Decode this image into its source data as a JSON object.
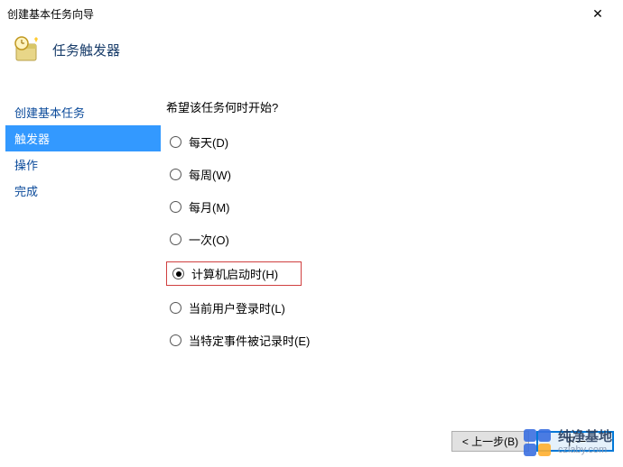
{
  "window": {
    "title": "创建基本任务向导"
  },
  "header": {
    "title": "任务触发器"
  },
  "sidebar": {
    "items": [
      {
        "label": "创建基本任务"
      },
      {
        "label": "触发器"
      },
      {
        "label": "操作"
      },
      {
        "label": "完成"
      }
    ]
  },
  "main": {
    "question": "希望该任务何时开始?",
    "options": [
      {
        "label": "每天(D)"
      },
      {
        "label": "每周(W)"
      },
      {
        "label": "每月(M)"
      },
      {
        "label": "一次(O)"
      },
      {
        "label": "计算机启动时(H)"
      },
      {
        "label": "当前用户登录时(L)"
      },
      {
        "label": "当特定事件被记录时(E)"
      }
    ]
  },
  "buttons": {
    "back": "< 上一步(B)",
    "next": "下一"
  },
  "watermark": {
    "title": "纯净基地",
    "url": "czlaby.com"
  }
}
